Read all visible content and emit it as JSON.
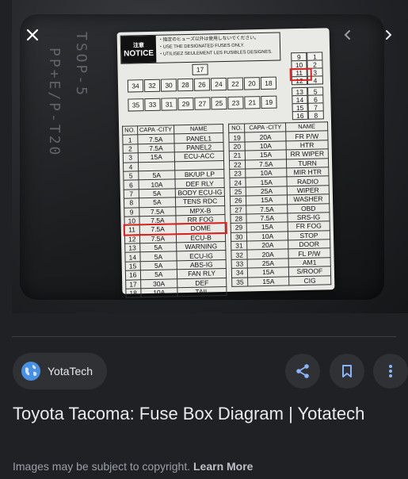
{
  "photo": {
    "molded_text_1": "PP+E/P-T20",
    "molded_text_2": "TSOP-5",
    "notice": {
      "tag_jp": "注意",
      "tag_en": "NOTICE",
      "line1": "・指定のヒューズ以外は使用しないでください。",
      "line2": "・USE THE DESIGNATED FUSES ONLY.",
      "line3": "・UTILISEZ SEULEMENT LES FUSIBLES DESIGNES."
    },
    "slot_17": "17",
    "row_top": [
      "34",
      "32",
      "30",
      "28",
      "26",
      "24",
      "22",
      "20",
      "18"
    ],
    "row_bottom": [
      "35",
      "33",
      "31",
      "29",
      "27",
      "25",
      "23",
      "21",
      "19"
    ],
    "right_pairs": [
      [
        "9",
        "1"
      ],
      [
        "10",
        "2"
      ],
      [
        "11",
        "3"
      ],
      [
        "12",
        "4"
      ]
    ],
    "right_pairs2": [
      [
        "13",
        "5"
      ],
      [
        "14",
        "6"
      ],
      [
        "15",
        "7"
      ],
      [
        "16",
        "8"
      ]
    ],
    "left_table": {
      "headers": [
        "NO.",
        "CAPA -CITY",
        "NAME"
      ],
      "rows": [
        [
          "1",
          "7.5A",
          "PANEL1"
        ],
        [
          "2",
          "7.5A",
          "PANEL2"
        ],
        [
          "3",
          "15A",
          "ECU-ACC"
        ],
        [
          "4",
          "",
          ""
        ],
        [
          "5",
          "5A",
          "BK/UP LP"
        ],
        [
          "6",
          "10A",
          "DEF RLY"
        ],
        [
          "7",
          "5A",
          "BODY ECU-IG"
        ],
        [
          "8",
          "5A",
          "TENS RDC"
        ],
        [
          "9",
          "7.5A",
          "MPX-B"
        ],
        [
          "10",
          "7.5A",
          "RR FOG"
        ],
        [
          "11",
          "7.5A",
          "DOME"
        ],
        [
          "12",
          "7.5A",
          "ECU-B"
        ],
        [
          "13",
          "5A",
          "WARNING"
        ],
        [
          "14",
          "5A",
          "ECU-IG"
        ],
        [
          "15",
          "5A",
          "ABS-IG"
        ],
        [
          "16",
          "5A",
          "FAN RLY"
        ],
        [
          "17",
          "30A",
          "DEF"
        ],
        [
          "18",
          "10A",
          "TAIL"
        ]
      ]
    },
    "right_table": {
      "headers": [
        "NO.",
        "CAPA -CITY",
        "NAME"
      ],
      "rows": [
        [
          "19",
          "20A",
          "FR P/W"
        ],
        [
          "20",
          "10A",
          "HTR"
        ],
        [
          "21",
          "15A",
          "RR WIPER"
        ],
        [
          "22",
          "7.5A",
          "TURN"
        ],
        [
          "23",
          "10A",
          "MIR HTR"
        ],
        [
          "24",
          "15A",
          "RADIO"
        ],
        [
          "25",
          "25A",
          "WIPER"
        ],
        [
          "26",
          "15A",
          "WASHER"
        ],
        [
          "27",
          "7.5A",
          "OBD"
        ],
        [
          "28",
          "7.5A",
          "SRS-IG"
        ],
        [
          "29",
          "15A",
          "FR FOG"
        ],
        [
          "30",
          "10A",
          "STOP"
        ],
        [
          "31",
          "20A",
          "DOOR"
        ],
        [
          "32",
          "20A",
          "FL P/W"
        ],
        [
          "33",
          "25A",
          "AM1"
        ],
        [
          "34",
          "15A",
          "S/ROOF"
        ],
        [
          "35",
          "15A",
          "CIG"
        ]
      ]
    }
  },
  "viewer": {
    "close_icon": "close-icon",
    "prev_icon": "chevron-left-icon",
    "next_icon": "chevron-right-icon"
  },
  "source": {
    "name": "YotaTech",
    "icon": "globe-icon",
    "icon_color": "#4a90e2"
  },
  "actions": {
    "share_icon": "share-icon",
    "save_icon": "bookmark-icon",
    "more_icon": "more-vert-icon",
    "accent": "#8ab4f8"
  },
  "title": "Toyota Tacoma: Fuse Box Diagram | Yotatech",
  "copyright": {
    "text": "Images may be subject to copyright.",
    "link": "Learn More"
  }
}
